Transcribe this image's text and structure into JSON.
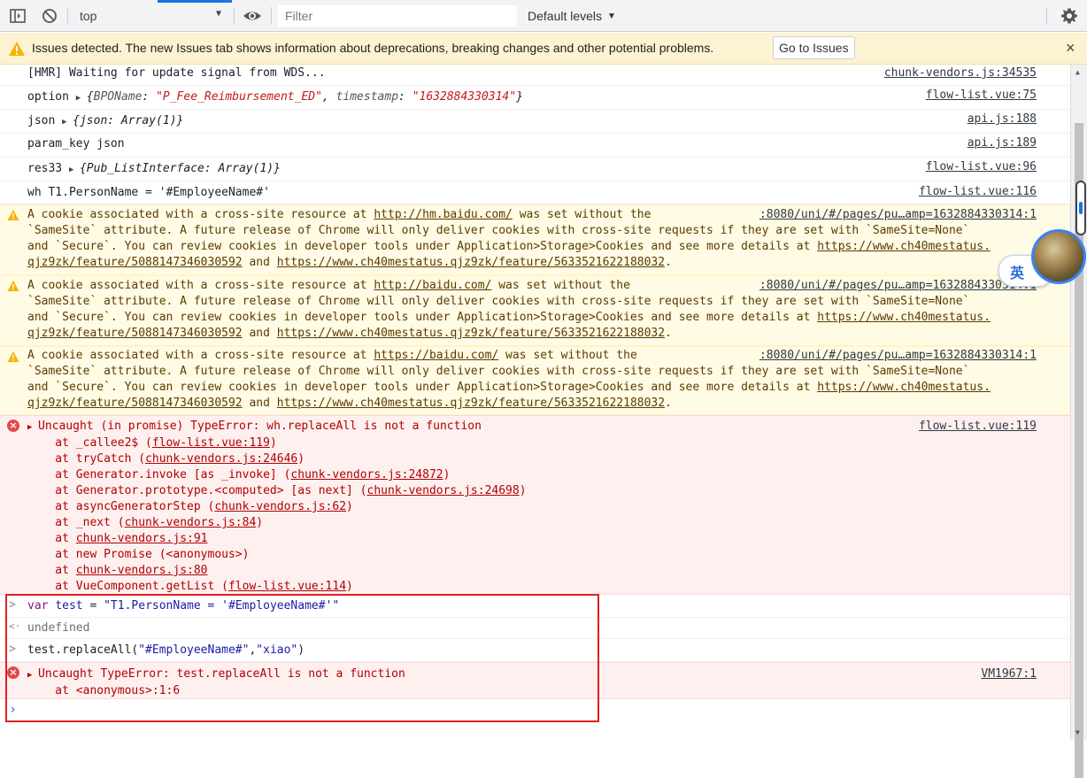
{
  "toolbar": {
    "context_value": "top",
    "filter_placeholder": "Filter",
    "levels_label": "Default levels",
    "dropdown_glyph": "▼"
  },
  "issues": {
    "message": "Issues detected. The new Issues tab shows information about deprecations, breaking changes and other potential problems.",
    "button_label": "Go to Issues",
    "close_glyph": "×"
  },
  "colors": {
    "warning_bg": "#fffbe5",
    "error_bg": "#fff0f0",
    "error_text": "#b00000",
    "highlight_border": "#e02020"
  },
  "logs": [
    {
      "text": "[HMR] Waiting for update signal from WDS...",
      "source": "chunk-vendors.js:34535"
    },
    {
      "label": "option",
      "obj": {
        "k1": "BPOName",
        "v1": "\"P_Fee_Reimbursement_ED\"",
        "k2": "timestamp",
        "v2": "\"1632884330314\""
      },
      "source": "flow-list.vue:75"
    },
    {
      "label": "json",
      "obj_text": "{json: Array(1)}",
      "source": "api.js:188"
    },
    {
      "text": "param_key json",
      "source": "api.js:189"
    },
    {
      "label": "res33",
      "obj_text": "{Pub_ListInterface: Array(1)}",
      "source": "flow-list.vue:96"
    },
    {
      "text": "wh T1.PersonName = '#EmployeeName#'",
      "source": "flow-list.vue:116"
    }
  ],
  "warnings": [
    {
      "pre": "A cookie associated with a cross-site resource at ",
      "url": "http://hm.baidu.com/",
      "post": " was set without the ",
      "source": ":8080/uni/#/pages/pu…amp=1632884330314:1",
      "line2": "`SameSite` attribute. A future release of Chrome will only deliver cookies with cross-site requests if they are set with `SameSite=None`",
      "line3_pre": "and `Secure`. You can review cookies in developer tools under Application>Storage>Cookies and see more details at ",
      "link1": "https://www.ch40mestatus.",
      "link1b": "qjz9zk/feature/5088147346030592",
      "and": " and ",
      "link2": "https://www.ch40mestatus.qjz9zk/feature/5633521622188032",
      "end": "."
    },
    {
      "pre": "A cookie associated with a cross-site resource at ",
      "url": "http://baidu.com/",
      "post": " was set without the ",
      "source": ":8080/uni/#/pages/pu…amp=1632884330314:1",
      "line2": "`SameSite` attribute. A future release of Chrome will only deliver cookies with cross-site requests if they are set with `SameSite=None`",
      "line3_pre": "and `Secure`. You can review cookies in developer tools under Application>Storage>Cookies and see more details at ",
      "link1": "https://www.ch40mestatus.",
      "link1b": "qjz9zk/feature/5088147346030592",
      "and": " and ",
      "link2": "https://www.ch40mestatus.qjz9zk/feature/5633521622188032",
      "end": "."
    },
    {
      "pre": "A cookie associated with a cross-site resource at ",
      "url": "https://baidu.com/",
      "post": " was set without the ",
      "source": ":8080/uni/#/pages/pu…amp=1632884330314:1",
      "line2": "`SameSite` attribute. A future release of Chrome will only deliver cookies with cross-site requests if they are set with `SameSite=None`",
      "line3_pre": "and `Secure`. You can review cookies in developer tools under Application>Storage>Cookies and see more details at ",
      "link1": "https://www.ch40mestatus.",
      "link1b": "qjz9zk/feature/5088147346030592",
      "and": " and ",
      "link2": "https://www.ch40mestatus.qjz9zk/feature/5633521622188032",
      "end": "."
    }
  ],
  "error1": {
    "head": "Uncaught (in promise) TypeError: wh.replaceAll is not a function",
    "source": "flow-list.vue:119",
    "stack": [
      {
        "pre": "    at _callee2$ (",
        "link": "flow-list.vue:119",
        "post": ")"
      },
      {
        "pre": "    at tryCatch (",
        "link": "chunk-vendors.js:24646",
        "post": ")"
      },
      {
        "pre": "    at Generator.invoke [as _invoke] (",
        "link": "chunk-vendors.js:24872",
        "post": ")"
      },
      {
        "pre": "    at Generator.prototype.<computed> [as next] (",
        "link": "chunk-vendors.js:24698",
        "post": ")"
      },
      {
        "pre": "    at asyncGeneratorStep (",
        "link": "chunk-vendors.js:62",
        "post": ")"
      },
      {
        "pre": "    at _next (",
        "link": "chunk-vendors.js:84",
        "post": ")"
      },
      {
        "pre": "    at ",
        "link": "chunk-vendors.js:91",
        "post": ""
      },
      {
        "pre": "    at new Promise (<anonymous>)",
        "link": "",
        "post": ""
      },
      {
        "pre": "    at ",
        "link": "chunk-vendors.js:80",
        "post": ""
      },
      {
        "pre": "    at VueComponent.getList (",
        "link": "flow-list.vue:114",
        "post": ")"
      }
    ]
  },
  "repl": {
    "in1_kw": "var",
    "in1_ident": "test",
    "in1_eq": " = ",
    "in1_str": "\"T1.PersonName = '#EmployeeName#'\"",
    "out1": "undefined",
    "in2_a": "test.replaceAll(",
    "in2_s1": "\"#EmployeeName#\"",
    "in2_comma": ",",
    "in2_s2": "\"xiao\"",
    "in2_b": ")",
    "err_head": "Uncaught TypeError: test.replaceAll is not a function",
    "err_stack": "    at <anonymous>:1:6",
    "err_source": "VM1967:1",
    "prompt_in": ">",
    "prompt_out": "<·",
    "caret": "›"
  },
  "ime": {
    "label": "英"
  }
}
